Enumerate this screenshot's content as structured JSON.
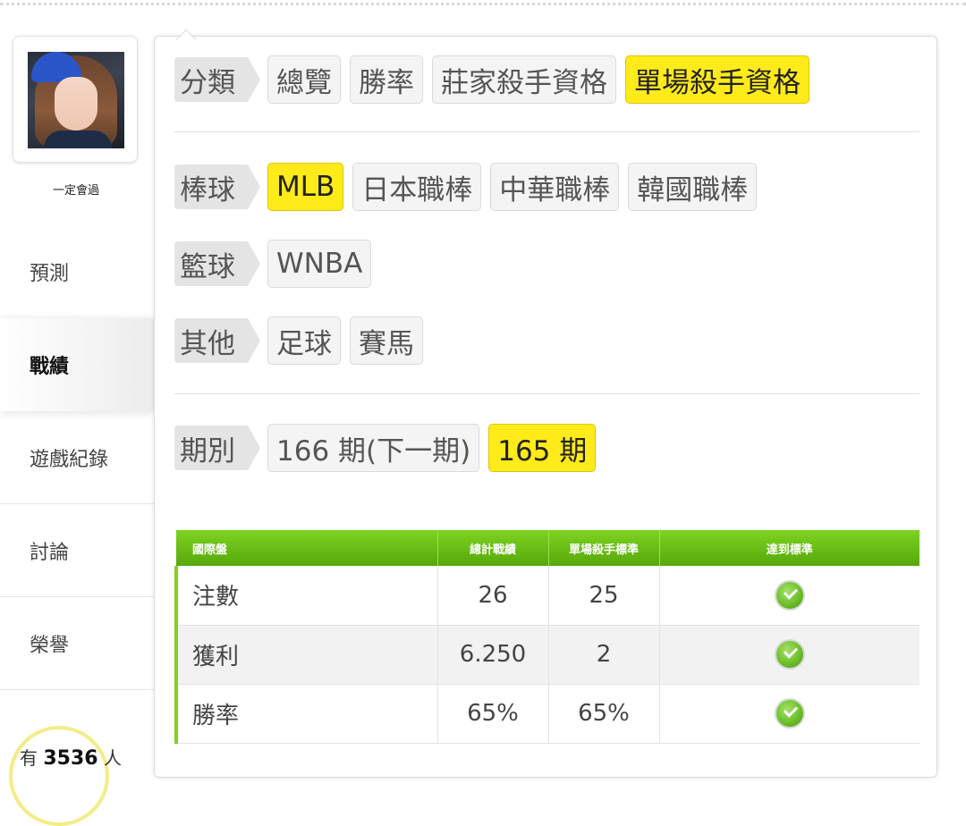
{
  "profile": {
    "nickname": "一定會過"
  },
  "sidebar": {
    "items": [
      {
        "label": "預測"
      },
      {
        "label": "戰績"
      },
      {
        "label": "遊戲紀錄"
      },
      {
        "label": "討論"
      },
      {
        "label": "榮譽"
      }
    ],
    "active_index": 1,
    "counter": {
      "prefix": "有",
      "value": "3536",
      "suffix": "人"
    }
  },
  "filters": {
    "category": {
      "label": "分類",
      "options": [
        "總覽",
        "勝率",
        "莊家殺手資格",
        "單場殺手資格"
      ],
      "selected": "單場殺手資格"
    },
    "baseball": {
      "label": "棒球",
      "options": [
        "MLB",
        "日本職棒",
        "中華職棒",
        "韓國職棒"
      ],
      "selected": "MLB"
    },
    "basketball": {
      "label": "籃球",
      "options": [
        "WNBA"
      ]
    },
    "other": {
      "label": "其他",
      "options": [
        "足球",
        "賽馬"
      ]
    },
    "period": {
      "label": "期別",
      "options": [
        "166 期(下一期)",
        "165 期"
      ],
      "selected": "165 期"
    }
  },
  "table": {
    "headers": [
      "國際盤",
      "總計戰績",
      "單場殺手標準",
      "達到標準"
    ],
    "rows": [
      {
        "name": "注數",
        "total": "26",
        "standard": "25",
        "met": true
      },
      {
        "name": "獲利",
        "total": "6.250",
        "standard": "2",
        "met": true
      },
      {
        "name": "勝率",
        "total": "65%",
        "standard": "65%",
        "met": true
      }
    ]
  },
  "colors": {
    "accent_yellow": "#ffeb1a",
    "table_header_green": "#6cc018",
    "check_green": "#6cc02a"
  }
}
